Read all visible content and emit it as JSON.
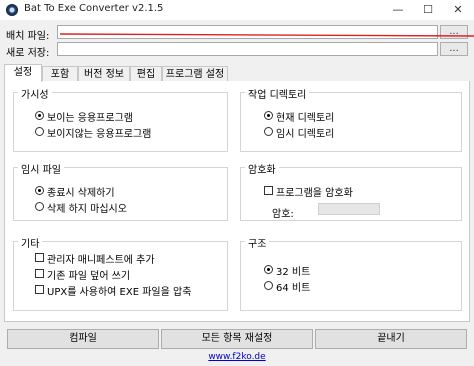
{
  "window": {
    "title": "Bat To Exe Converter v2.1.5",
    "minimize_glyph": "—",
    "maximize_glyph": "☐",
    "close_glyph": "✕",
    "app_icon": "gear-icon"
  },
  "inputs": {
    "batch_file_label": "배치 파일:",
    "batch_file_value": "",
    "batch_browse": "...",
    "save_as_label": "새로 저장:",
    "save_as_value": "",
    "save_browse": "..."
  },
  "tabs": [
    "설정",
    "포함",
    "버전 정보",
    "편집",
    "프로그램 설정"
  ],
  "active_tab": 0,
  "groups": {
    "visibility": {
      "title": "가시성",
      "options": [
        "보이는 응용프로그램",
        "보이지않는 응용프로그램"
      ],
      "selected": 0
    },
    "working_dir": {
      "title": "작업 디렉토리",
      "options": [
        "현재 디렉토리",
        "임시 디렉토리"
      ],
      "selected": 0
    },
    "temp_file": {
      "title": "임시 파일",
      "options": [
        "종료시 삭제하기",
        "삭제 하지 마십시오"
      ],
      "selected": 0
    },
    "encryption": {
      "title": "암호화",
      "checkbox": "프로그램을 암호화",
      "checked": false,
      "password_label": "암호:",
      "password_value": ""
    },
    "other": {
      "title": "기타",
      "checkboxes": [
        "관리자 매니페스트에 추가",
        "기존 파일 덮어 쓰기",
        "UPX를 사용하여 EXE 파일을 압축"
      ]
    },
    "architecture": {
      "title": "구조",
      "options": [
        "32 비트",
        "64 비트"
      ],
      "selected": 0
    }
  },
  "buttons": {
    "compile": "컴파일",
    "reset": "모든 항목 재설정",
    "exit": "끝내기"
  },
  "footer_link": "www.f2ko.de",
  "colors": {
    "annotation_red": "#e02020",
    "link_blue": "#0000cc"
  }
}
